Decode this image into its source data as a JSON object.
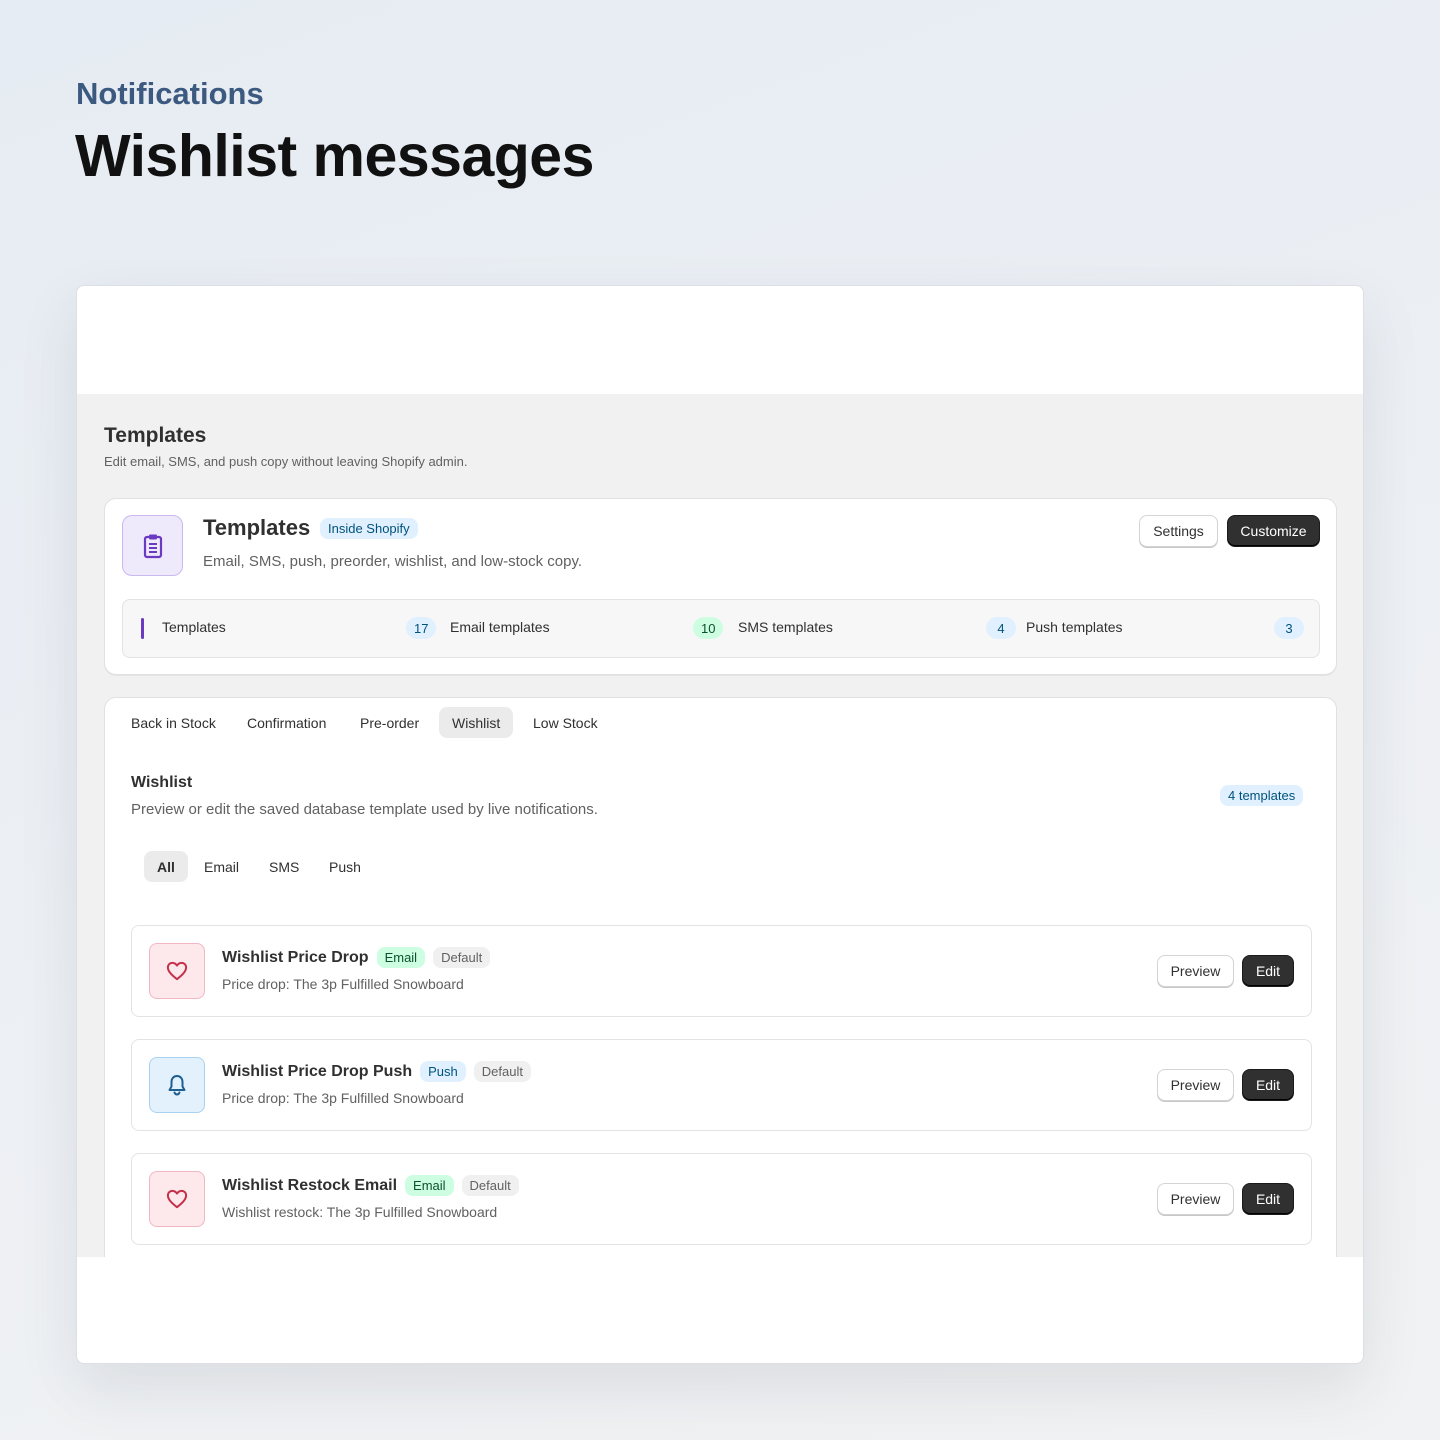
{
  "hero": {
    "eyebrow": "Notifications",
    "headline": "Wishlist messages"
  },
  "page": {
    "title": "Templates",
    "subtitle": "Edit email, SMS, and push copy without leaving Shopify admin."
  },
  "summary_card": {
    "icon": "clipboard-icon",
    "title": "Templates",
    "badge": "Inside Shopify",
    "description": "Email, SMS, push, preorder, wishlist, and low-stock copy.",
    "settings_label": "Settings",
    "customize_label": "Customize",
    "stats": [
      {
        "label": "Templates",
        "value": "17",
        "color": "blue"
      },
      {
        "label": "Email templates",
        "value": "10",
        "color": "green"
      },
      {
        "label": "SMS templates",
        "value": "4",
        "color": "blue"
      },
      {
        "label": "Push templates",
        "value": "3",
        "color": "blue"
      }
    ]
  },
  "tabs": [
    "Back in Stock",
    "Confirmation",
    "Pre-order",
    "Wishlist",
    "Low Stock"
  ],
  "active_tab": "Wishlist",
  "section": {
    "title": "Wishlist",
    "subtitle": "Preview or edit the saved database template used by live notifications.",
    "count_badge": "4 templates"
  },
  "filters": [
    "All",
    "Email",
    "SMS",
    "Push"
  ],
  "active_filter": "All",
  "templates": [
    {
      "icon": "heart-icon",
      "title": "Wishlist Price Drop",
      "channel": "Email",
      "tag": "Default",
      "subtitle": "Price drop: The 3p Fulfilled Snowboard",
      "preview_label": "Preview",
      "edit_label": "Edit"
    },
    {
      "icon": "bell-icon",
      "title": "Wishlist Price Drop Push",
      "channel": "Push",
      "tag": "Default",
      "subtitle": "Price drop: The 3p Fulfilled Snowboard",
      "preview_label": "Preview",
      "edit_label": "Edit"
    },
    {
      "icon": "heart-icon",
      "title": "Wishlist Restock Email",
      "channel": "Email",
      "tag": "Default",
      "subtitle": "Wishlist restock: The 3p Fulfilled Snowboard",
      "preview_label": "Preview",
      "edit_label": "Edit"
    }
  ],
  "colors": {
    "accent_purple": "#6a3ac0",
    "primary_button": "#303030",
    "eyebrow": "#3c5a80"
  }
}
